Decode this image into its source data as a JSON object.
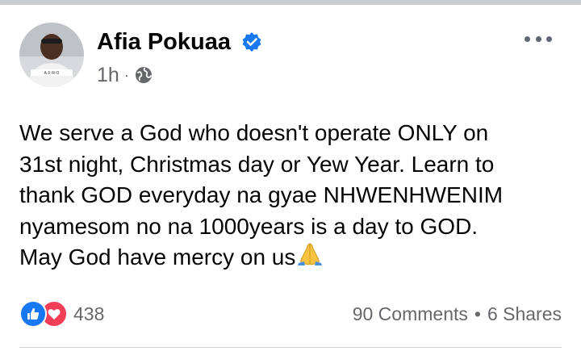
{
  "post": {
    "author": "Afia Pokuaa",
    "timestamp": "1h",
    "separator": "·",
    "privacy_icon": "globe-icon",
    "verified_icon": "verified-badge-icon",
    "more_icon": "more-options-icon",
    "text_lines": [
      "We serve a God who doesn't operate ONLY on",
      "31st night, Christmas day or Yew Year. Learn to",
      "thank GOD everyday na gyae NHWENHWENIM",
      "nyamesom no na 1000years is a day to GOD.",
      "May God have mercy on us"
    ],
    "text_emoji": "folded-hands-icon"
  },
  "engagement": {
    "reaction_icons": [
      "like-icon",
      "love-icon"
    ],
    "reaction_count": "438",
    "comments": "90 Comments",
    "separator": "•",
    "shares": "6 Shares"
  },
  "colors": {
    "like_blue": "#1877f2",
    "love_red": "#f33e58",
    "verified_blue": "#1877f2",
    "meta_gray": "#65676b"
  }
}
